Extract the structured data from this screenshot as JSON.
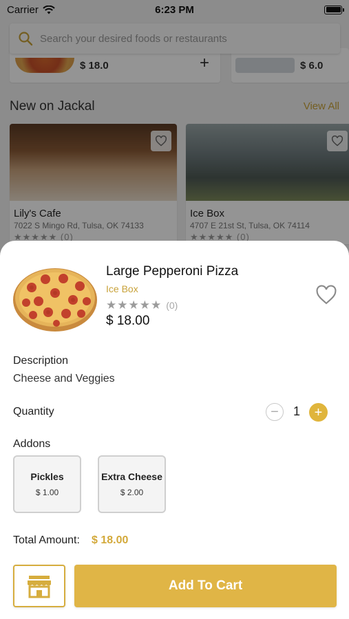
{
  "status_bar": {
    "carrier": "Carrier",
    "time": "6:23 PM"
  },
  "background": {
    "search": {
      "placeholder": "Search your desired foods or restaurants",
      "icon": "search-icon"
    },
    "top_cards": [
      {
        "price": "$ 18.0"
      },
      {
        "price": "$ 6.0"
      }
    ],
    "section": {
      "title": "New on Jackal",
      "view_all": "View All"
    },
    "restaurants": [
      {
        "name": "Lily's Cafe",
        "address": "7022 S Mingo Rd, Tulsa, OK 74133",
        "stars": "★★★★★",
        "reviews": "(0)"
      },
      {
        "name": "Ice Box",
        "address": "4707 E 21st St, Tulsa, OK 74114",
        "stars": "★★★★★",
        "reviews": "(0)"
      }
    ]
  },
  "item": {
    "title": "Large Pepperoni Pizza",
    "restaurant": "Ice Box",
    "stars": "★★★★★",
    "rating": 0,
    "review_count": "(0)",
    "price": "$ 18.00"
  },
  "description": {
    "label": "Description",
    "text": "Cheese and Veggies"
  },
  "quantity": {
    "label": "Quantity",
    "value": "1",
    "minus": "−",
    "plus": "+"
  },
  "addons": {
    "label": "Addons",
    "items": [
      {
        "name": "Pickles",
        "price": "$ 1.00"
      },
      {
        "name": "Extra Cheese",
        "price": "$ 2.00"
      }
    ]
  },
  "total": {
    "label": "Total Amount:",
    "value": "$ 18.00"
  },
  "actions": {
    "add_to_cart": "Add To Cart",
    "store_icon": "store-icon"
  },
  "colors": {
    "accent": "#e0b546",
    "accent_text": "#c8a23a",
    "overlay": "rgba(0,0,0,0.42)"
  }
}
